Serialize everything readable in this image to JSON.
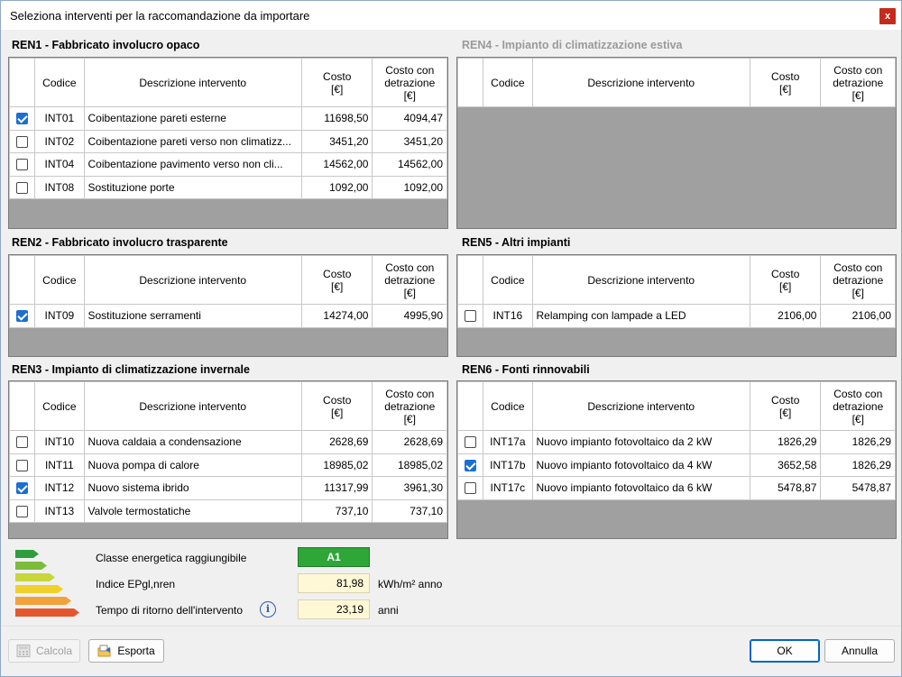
{
  "window": {
    "title": "Seleziona interventi per la raccomandazione da importare",
    "close_label": "x"
  },
  "columns": {
    "code": "Codice",
    "desc": "Descrizione intervento",
    "cost_l1": "Costo",
    "cost_l2": "[€]",
    "costd_l1": "Costo con",
    "costd_l2": "detrazione",
    "costd_l3": "[€]"
  },
  "groups": {
    "ren1": {
      "title": "REN1 - Fabbricato involucro opaco",
      "rows": [
        {
          "checked": true,
          "code": "INT01",
          "desc": "Coibentazione pareti esterne",
          "cost": "11698,50",
          "cost_ded": "4094,47"
        },
        {
          "checked": false,
          "code": "INT02",
          "desc": "Coibentazione pareti verso non climatizz...",
          "cost": "3451,20",
          "cost_ded": "3451,20"
        },
        {
          "checked": false,
          "code": "INT04",
          "desc": "Coibentazione pavimento verso non cli...",
          "cost": "14562,00",
          "cost_ded": "14562,00"
        },
        {
          "checked": false,
          "code": "INT08",
          "desc": "Sostituzione porte",
          "cost": "1092,00",
          "cost_ded": "1092,00"
        }
      ]
    },
    "ren2": {
      "title": "REN2 - Fabbricato involucro trasparente",
      "rows": [
        {
          "checked": true,
          "code": "INT09",
          "desc": "Sostituzione serramenti",
          "cost": "14274,00",
          "cost_ded": "4995,90"
        }
      ]
    },
    "ren3": {
      "title": "REN3 - Impianto di climatizzazione invernale",
      "rows": [
        {
          "checked": false,
          "code": "INT10",
          "desc": "Nuova caldaia a condensazione",
          "cost": "2628,69",
          "cost_ded": "2628,69"
        },
        {
          "checked": false,
          "code": "INT11",
          "desc": "Nuova pompa di calore",
          "cost": "18985,02",
          "cost_ded": "18985,02"
        },
        {
          "checked": true,
          "code": "INT12",
          "desc": "Nuovo sistema ibrido",
          "cost": "11317,99",
          "cost_ded": "3961,30"
        },
        {
          "checked": false,
          "code": "INT13",
          "desc": "Valvole termostatiche",
          "cost": "737,10",
          "cost_ded": "737,10"
        }
      ]
    },
    "ren4": {
      "title": "REN4 - Impianto di climatizzazione estiva",
      "rows": []
    },
    "ren5": {
      "title": "REN5 - Altri impianti",
      "rows": [
        {
          "checked": false,
          "code": "INT16",
          "desc": "Relamping con lampade a LED",
          "cost": "2106,00",
          "cost_ded": "2106,00"
        }
      ]
    },
    "ren6": {
      "title": "REN6 - Fonti rinnovabili",
      "rows": [
        {
          "checked": false,
          "code": "INT17a",
          "desc": "Nuovo impianto fotovoltaico da 2 kW",
          "cost": "1826,29",
          "cost_ded": "1826,29"
        },
        {
          "checked": true,
          "code": "INT17b",
          "desc": "Nuovo impianto fotovoltaico da 4 kW",
          "cost": "3652,58",
          "cost_ded": "1826,29"
        },
        {
          "checked": false,
          "code": "INT17c",
          "desc": "Nuovo impianto fotovoltaico da 6 kW",
          "cost": "5478,87",
          "cost_ded": "5478,87"
        }
      ]
    }
  },
  "summary": {
    "class_label": "Classe energetica raggiungibile",
    "class_value": "A1",
    "class_color": "#2ea638",
    "epgl_label": "Indice EPgl,nren",
    "epgl_value": "81,98",
    "epgl_unit": "kWh/m² anno",
    "payback_label": "Tempo di ritorno dell'intervento",
    "payback_value": "23,19",
    "payback_unit": "anni",
    "energy_bar_colors": [
      "#2e9e3a",
      "#7dbb3b",
      "#c8d63a",
      "#f0d12c",
      "#f2a23a",
      "#e4572e"
    ]
  },
  "footer": {
    "calcola_label": "Calcola",
    "esporta_label": "Esporta",
    "ok_label": "OK",
    "annulla_label": "Annulla"
  }
}
